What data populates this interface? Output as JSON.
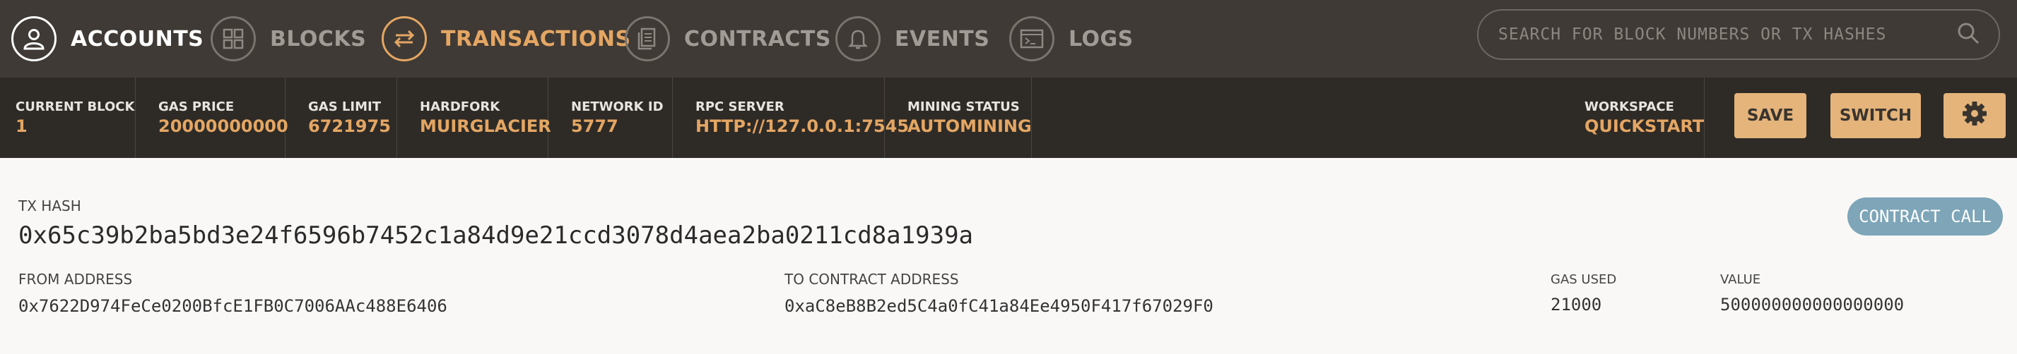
{
  "nav": {
    "items": [
      {
        "label": "ACCOUNTS",
        "icon": "person-icon"
      },
      {
        "label": "BLOCKS",
        "icon": "grid-icon"
      },
      {
        "label": "TRANSACTIONS",
        "icon": "exchange-arrows-icon"
      },
      {
        "label": "CONTRACTS",
        "icon": "document-icon"
      },
      {
        "label": "EVENTS",
        "icon": "bell-icon"
      },
      {
        "label": "LOGS",
        "icon": "terminal-icon"
      }
    ],
    "search_placeholder": "SEARCH FOR BLOCK NUMBERS OR TX HASHES"
  },
  "status": {
    "current_block": {
      "label": "CURRENT BLOCK",
      "value": "1"
    },
    "gas_price": {
      "label": "GAS PRICE",
      "value": "20000000000"
    },
    "gas_limit": {
      "label": "GAS LIMIT",
      "value": "6721975"
    },
    "hardfork": {
      "label": "HARDFORK",
      "value": "MUIRGLACIER"
    },
    "network_id": {
      "label": "NETWORK ID",
      "value": "5777"
    },
    "rpc_server": {
      "label": "RPC SERVER",
      "value": "HTTP://127.0.0.1:7545"
    },
    "mining_status": {
      "label": "MINING STATUS",
      "value": "AUTOMINING"
    },
    "workspace": {
      "label": "WORKSPACE",
      "value": "QUICKSTART"
    },
    "save_label": "SAVE",
    "switch_label": "SWITCH"
  },
  "tx": {
    "hash_label": "TX HASH",
    "hash": "0x65c39b2ba5bd3e24f6596b7452c1a84d9e21ccd3078d4aea2ba0211cd8a1939a",
    "type_badge": "CONTRACT CALL",
    "from_label": "FROM ADDRESS",
    "from": "0x7622D974FeCe0200BfcE1FB0C7006AAc488E6406",
    "to_label": "TO CONTRACT ADDRESS",
    "to": "0xaC8eB8B2ed5C4a0fC41a84Ee4950F417f67029F0",
    "gas_used_label": "GAS USED",
    "gas_used": "21000",
    "value_label": "VALUE",
    "value": "500000000000000000"
  },
  "colors": {
    "accent": "#e4a663",
    "nav_bg": "#3f3a35",
    "status_bg": "#2e2b27",
    "badge": "#7ea5b8"
  }
}
